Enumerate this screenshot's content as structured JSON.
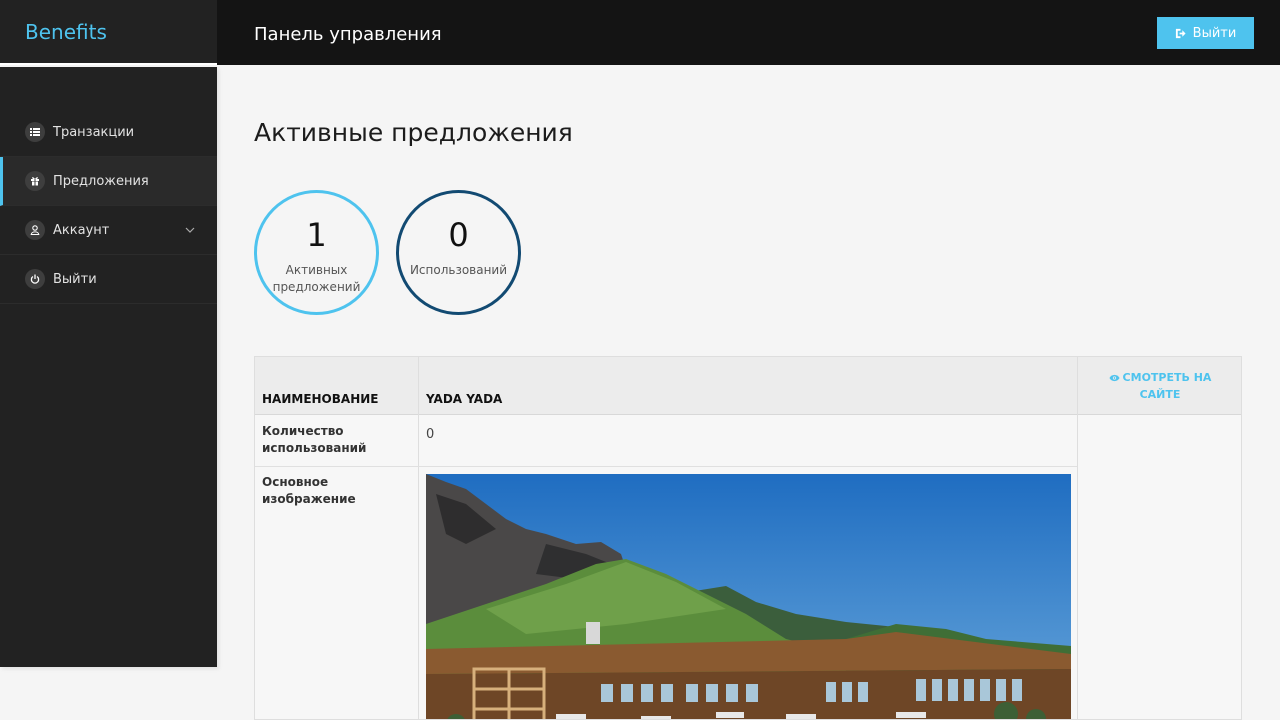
{
  "app": {
    "brand": "Benefits"
  },
  "header": {
    "title": "Панель управления",
    "logout_label": "Выйти"
  },
  "sidebar": {
    "items": [
      {
        "label": "Транзакции",
        "icon": "list-icon"
      },
      {
        "label": "Предложения",
        "icon": "gift-icon",
        "active": true
      },
      {
        "label": "Аккаунт",
        "icon": "user-icon",
        "has_submenu": true
      },
      {
        "label": "Выйти",
        "icon": "power-icon"
      }
    ]
  },
  "main": {
    "title": "Активные предложения",
    "stats": [
      {
        "value": "1",
        "caption": "Активных предложений"
      },
      {
        "value": "0",
        "caption": "Использований"
      }
    ],
    "table": {
      "header_label": "НАИМЕНОВАНИЕ",
      "offer_name": "YADA YADA",
      "view_link": "СМОТРЕТЬ НА САЙТЕ",
      "rows": [
        {
          "label": "Количество использований",
          "value": "0"
        },
        {
          "label": "Основное изображение",
          "value": ""
        }
      ]
    }
  },
  "colors": {
    "accent": "#4ec3ee",
    "dark_accent": "#124a72",
    "sidebar_bg": "#222222",
    "topbar_bg": "#141414"
  }
}
